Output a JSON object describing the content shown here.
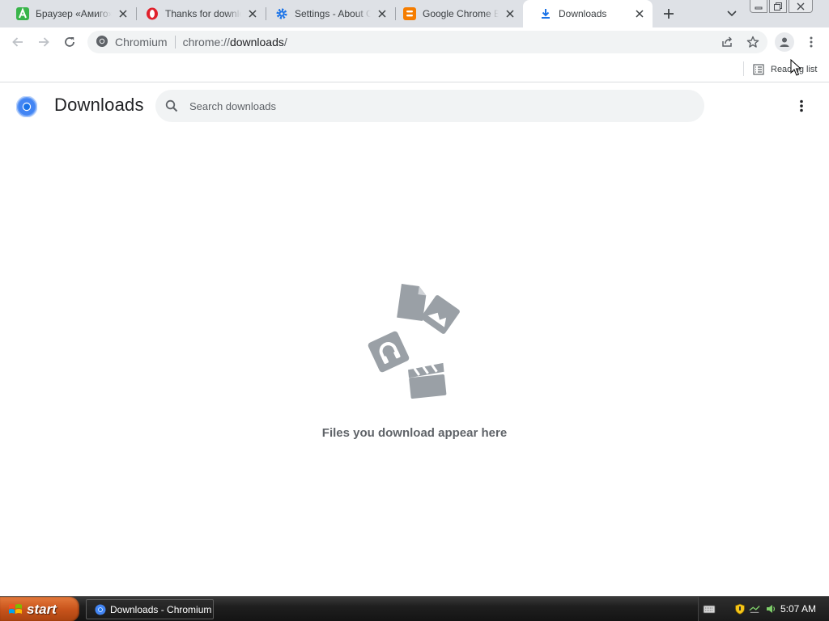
{
  "browser": {
    "tabs": [
      {
        "title": "Браузер «Амиго» - ",
        "icon": "amigo-icon",
        "active": false
      },
      {
        "title": "Thanks for downloading",
        "icon": "opera-icon",
        "active": false
      },
      {
        "title": "Settings - About Chromium",
        "icon": "settings-gear-icon",
        "active": false
      },
      {
        "title": "Google Chrome Blog",
        "icon": "blogger-icon",
        "active": false
      },
      {
        "title": "Downloads",
        "icon": "download-icon",
        "active": true
      }
    ],
    "omnibox": {
      "chip_label": "Chromium",
      "url_scheme": "chrome://",
      "url_host": "downloads",
      "url_rest": "/"
    },
    "bookmarks_bar": {
      "reading_list_label": "Reading list"
    }
  },
  "downloads_page": {
    "title": "Downloads",
    "search_placeholder": "Search downloads",
    "empty_message": "Files you download appear here"
  },
  "taskbar": {
    "start_label": "start",
    "task_button_label": "Downloads - Chromium",
    "clock": "5:07 AM"
  },
  "colors": {
    "tabstrip": "#dee1e6",
    "omnibox": "#f1f3f4",
    "empty_art": "#9aa0a6",
    "chrome_blue": "#4285f4"
  }
}
